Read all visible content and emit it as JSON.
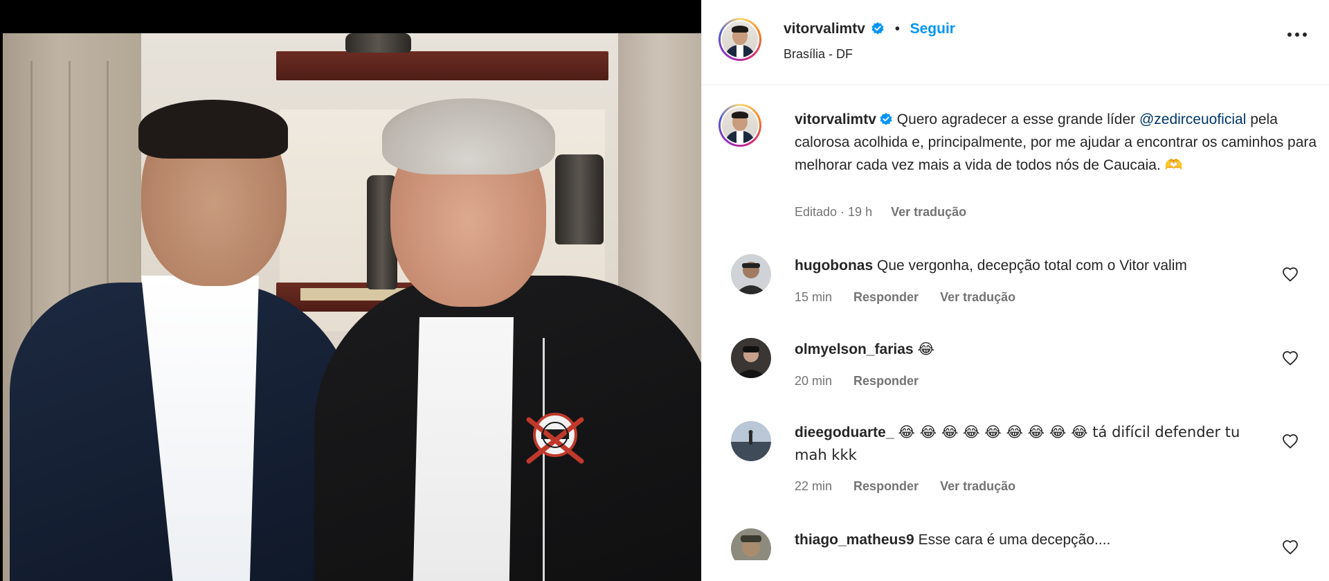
{
  "post": {
    "username": "vitorvalimtv",
    "follow_label": "Seguir",
    "separator": "•",
    "location": "Brasília - DF",
    "caption_username": "vitorvalimtv",
    "caption_pre": "Quero agradecer a esse grande líder",
    "caption_mention": "@zedirceuoficial",
    "caption_post": "pela calorosa acolhida e, principalmente, por me ajudar a encontrar os caminhos para melhorar cada vez mais a vida de todos nós de Caucaia.",
    "caption_emoji": "🫶",
    "edited_time": "Editado · 19 h",
    "see_translation": "Ver tradução"
  },
  "comments": [
    {
      "username": "hugobonas",
      "text": "Que vergonha, decepção total com o Vitor valim",
      "time": "15 min",
      "reply": "Responder",
      "translate": "Ver tradução"
    },
    {
      "username": "olmyelson_farias",
      "text": "😂",
      "time": "20 min",
      "reply": "Responder"
    },
    {
      "username": "dieegoduarte_",
      "text": "😂 😂 😂 😂 😂 😂 😂 😂 😂  tá difícil defender tu mah kkk",
      "time": "22 min",
      "reply": "Responder",
      "translate": "Ver tradução"
    },
    {
      "username": "thiago_matheus9",
      "text": "Esse cara é uma decepção...."
    }
  ],
  "icons": {
    "verified": "verified-badge-icon",
    "more": "more-options-icon",
    "like": "heart-icon"
  },
  "colors": {
    "accent_blue": "#0095f6",
    "mention_blue": "#00376b",
    "text": "#262626",
    "secondary": "#737373"
  }
}
